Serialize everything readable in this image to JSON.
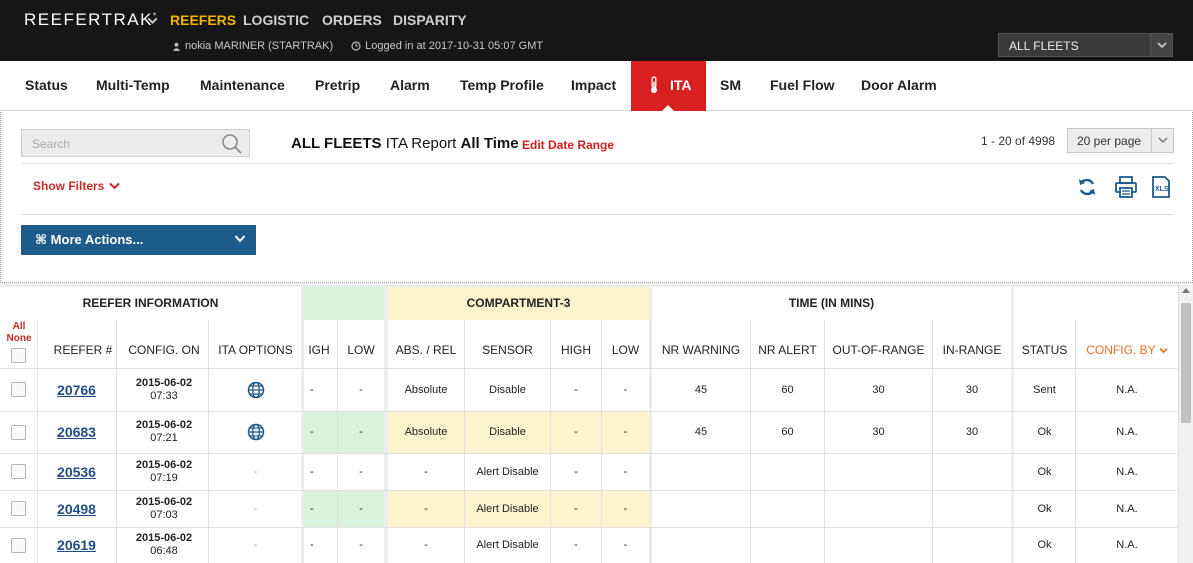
{
  "app": {
    "brand": "REEFERTRAK",
    "brand_mark": "*",
    "nav": [
      "REEFERS",
      "LOGISTIC",
      "ORDERS",
      "DISPARITY"
    ],
    "user": "nokia MARINER (STARTRAK)",
    "login": "Logged in at 2017-10-31 05:07 GMT",
    "fleet_select": "ALL FLEETS"
  },
  "tabs": [
    "Status",
    "Multi-Temp",
    "Maintenance",
    "Pretrip",
    "Alarm",
    "Temp Profile",
    "Impact",
    "ITA",
    "SM",
    "Fuel Flow",
    "Door Alarm"
  ],
  "active_tab": "ITA",
  "toolbar": {
    "search_placeholder": "Search",
    "report_fleet": "ALL FLEETS",
    "report_name": "ITA Report",
    "report_range": "All Time",
    "edit_date_range": "Edit Date Range",
    "pager": "1 - 20 of 4998",
    "per_page": "20 per page",
    "show_filters": "Show Filters",
    "more_actions": "⌘ More Actions..."
  },
  "table": {
    "groups": {
      "reefer_info": "REEFER INFORMATION",
      "compartment": "COMPARTMENT-3",
      "time": "TIME (IN MINS)"
    },
    "all_label": "All",
    "none_label": "None",
    "columns": {
      "reefer": "REEFER #",
      "config_on": "CONFIG. ON",
      "ita_options": "ITA OPTIONS",
      "high_a": "IGH",
      "low_a": "LOW",
      "abs_rel": "ABS. / REL",
      "sensor": "SENSOR",
      "high_b": "HIGH",
      "low_b": "LOW",
      "nr_warning": "NR WARNING",
      "nr_alert": "NR ALERT",
      "out_of_range": "OUT-OF-RANGE",
      "in_range": "IN-RANGE",
      "status": "STATUS",
      "config_by": "CONFIG. BY"
    },
    "rows": [
      {
        "reefer": "20766",
        "date": "2015-06-02",
        "time": "07:33",
        "ita": "globe",
        "high_a": "-",
        "low_a": "-",
        "abs_rel": "Absolute",
        "sensor": "Disable",
        "high_b": "-",
        "low_b": "-",
        "nr_warning": "45",
        "nr_alert": "60",
        "out_of_range": "30",
        "in_range": "30",
        "status": "Sent",
        "config_by": "N.A."
      },
      {
        "reefer": "20683",
        "date": "2015-06-02",
        "time": "07:21",
        "ita": "globe",
        "high_a": "-",
        "low_a": "-",
        "abs_rel": "Absolute",
        "sensor": "Disable",
        "high_b": "-",
        "low_b": "-",
        "nr_warning": "45",
        "nr_alert": "60",
        "out_of_range": "30",
        "in_range": "30",
        "status": "Ok",
        "config_by": "N.A."
      },
      {
        "reefer": "20536",
        "date": "2015-06-02",
        "time": "07:19",
        "ita": "-",
        "high_a": "-",
        "low_a": "-",
        "abs_rel": "-",
        "sensor": "Alert Disable",
        "high_b": "-",
        "low_b": "-",
        "nr_warning": "",
        "nr_alert": "",
        "out_of_range": "",
        "in_range": "",
        "status": "Ok",
        "config_by": "N.A."
      },
      {
        "reefer": "20498",
        "date": "2015-06-02",
        "time": "07:03",
        "ita": "-",
        "high_a": "-",
        "low_a": "-",
        "abs_rel": "-",
        "sensor": "Alert Disable",
        "high_b": "-",
        "low_b": "-",
        "nr_warning": "",
        "nr_alert": "",
        "out_of_range": "",
        "in_range": "",
        "status": "Ok",
        "config_by": "N.A."
      },
      {
        "reefer": "20619",
        "date": "2015-06-02",
        "time": "06:48",
        "ita": "-",
        "high_a": "-",
        "low_a": "-",
        "abs_rel": "-",
        "sensor": "Alert Disable",
        "high_b": "-",
        "low_b": "-",
        "nr_warning": "",
        "nr_alert": "",
        "out_of_range": "",
        "in_range": "",
        "status": "Ok",
        "config_by": "N.A."
      }
    ]
  },
  "colors": {
    "accent_red": "#d92020",
    "nav_active": "#f5b400",
    "link_blue": "#1f4e8a",
    "action_blue": "#1c5b8a",
    "green_band": "#d9f2dd",
    "yellow_band": "#fdf4cf"
  }
}
